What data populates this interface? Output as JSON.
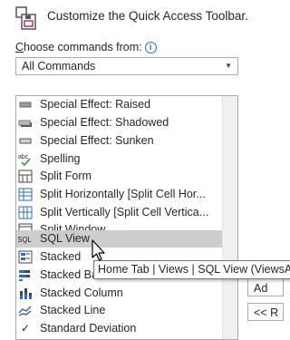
{
  "dialog": {
    "title": "Customize the Quick Access Toolbar.",
    "choose_label_prefix": "",
    "choose_label_underlined": "C",
    "choose_label_rest": "hoose commands from:",
    "info_glyph": "i"
  },
  "commands_combo": {
    "selected": "All Commands"
  },
  "commands": [
    {
      "label": "Special Effect: Raised",
      "icon": "raised-icon"
    },
    {
      "label": "Special Effect: Shadowed",
      "icon": "shadowed-icon"
    },
    {
      "label": "Special Effect: Sunken",
      "icon": "sunken-icon"
    },
    {
      "label": "Spelling",
      "icon": "spelling-icon",
      "icon_text": "abc"
    },
    {
      "label": "Split Form",
      "icon": "split-form-icon"
    },
    {
      "label": "Split Horizontally [Split Cell Hor...",
      "icon": "split-horizontal-icon"
    },
    {
      "label": "Split Vertically [Split Cell Vertica...",
      "icon": "split-vertical-icon"
    },
    {
      "label": "Split Window",
      "icon": "split-window-icon"
    },
    {
      "label": "SQL View",
      "icon": "sql-icon",
      "icon_text": "SQL"
    },
    {
      "label": "Stacked",
      "icon": "stacked-icon"
    },
    {
      "label": "Stacked Ba",
      "icon": "stacked-bar-icon"
    },
    {
      "label": "Stacked Column",
      "icon": "stacked-column-icon"
    },
    {
      "label": "Stacked Line",
      "icon": "stacked-line-icon"
    },
    {
      "label": "Standard Deviation",
      "icon": "checkmark-icon",
      "icon_text": "✓"
    }
  ],
  "tooltip": {
    "text": "Home Tab | Views | SQL View (ViewsAc"
  },
  "side_buttons": {
    "add_label": "Ad",
    "remove_label": "<< R"
  },
  "colors": {
    "selection": "#cdcdcd",
    "info_blue": "#2b6cc4",
    "logo_magenta": "#b4326e"
  }
}
